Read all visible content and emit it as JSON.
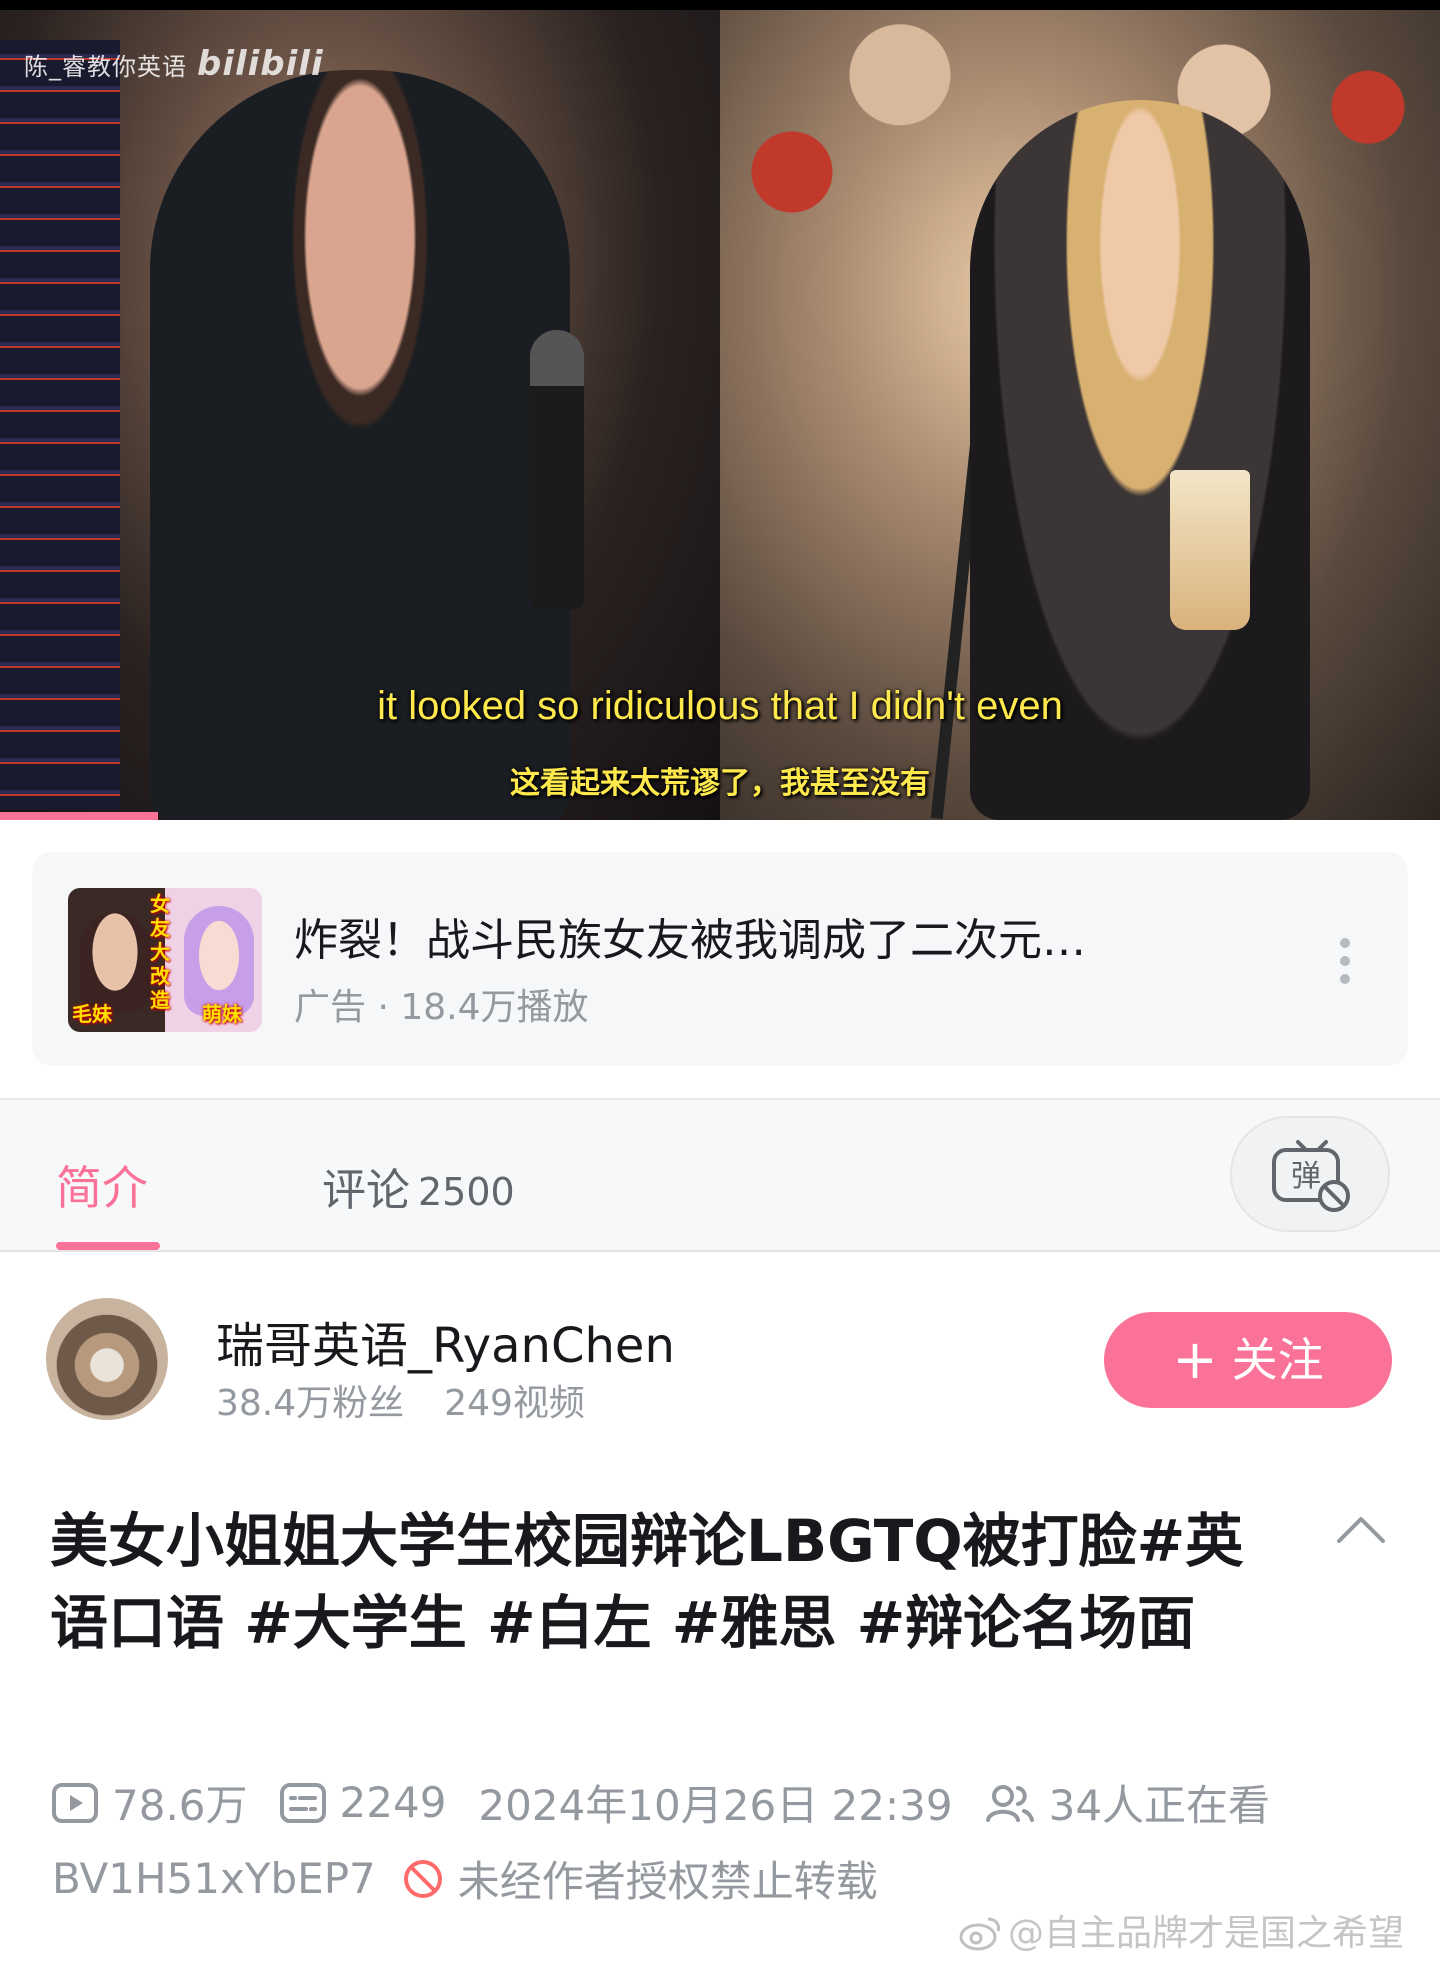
{
  "player": {
    "watermark_text": "陈_睿教你英语",
    "watermark_logo": "bilibili",
    "subtitle_en": "it looked so ridiculous that I didn't even",
    "subtitle_zh": "这看起来太荒谬了，我甚至没有",
    "progress_fraction": 0.11
  },
  "ad": {
    "title": "炸裂！战斗民族女友被我调成了二次元…",
    "meta": "广告 · 18.4万播放",
    "thumb_vertical_text": "女友大改造",
    "thumb_left_tag": "毛妹",
    "thumb_right_tag": "萌妹"
  },
  "tabs": {
    "intro_label": "简介",
    "comments_label": "评论",
    "comments_count": "2500",
    "danmaku_glyph": "弹"
  },
  "uploader": {
    "name": "瑞哥英语_RyanChen",
    "followers": "38.4万粉丝",
    "videos": "249视频",
    "follow_label": "关注",
    "follow_plus": "+"
  },
  "video": {
    "title": "美女小姐姐大学生校园辩论LBGTQ被打脸#英语口语 #大学生 #白左 #雅思 #辩论名场面",
    "plays": "78.6万",
    "danmaku_count": "2249",
    "publish_time": "2024年10月26日 22:39",
    "watching": "34人正在看",
    "bvid": "BV1H51xYbEP7",
    "copyright_notice": "未经作者授权禁止转载"
  },
  "overlay": {
    "weibo_watermark": "@自主品牌才是国之希望"
  },
  "colors": {
    "accent": "#fb7299",
    "subtitle": "#ffe94d",
    "muted_text": "#9499a0",
    "warning": "#ff6b6b"
  },
  "icons": [
    "play-count-icon",
    "danmaku-count-icon",
    "watching-icon",
    "no-repost-icon",
    "collapse-chevron-icon",
    "danmaku-toggle-icon",
    "more-dots-icon",
    "weibo-icon"
  ]
}
